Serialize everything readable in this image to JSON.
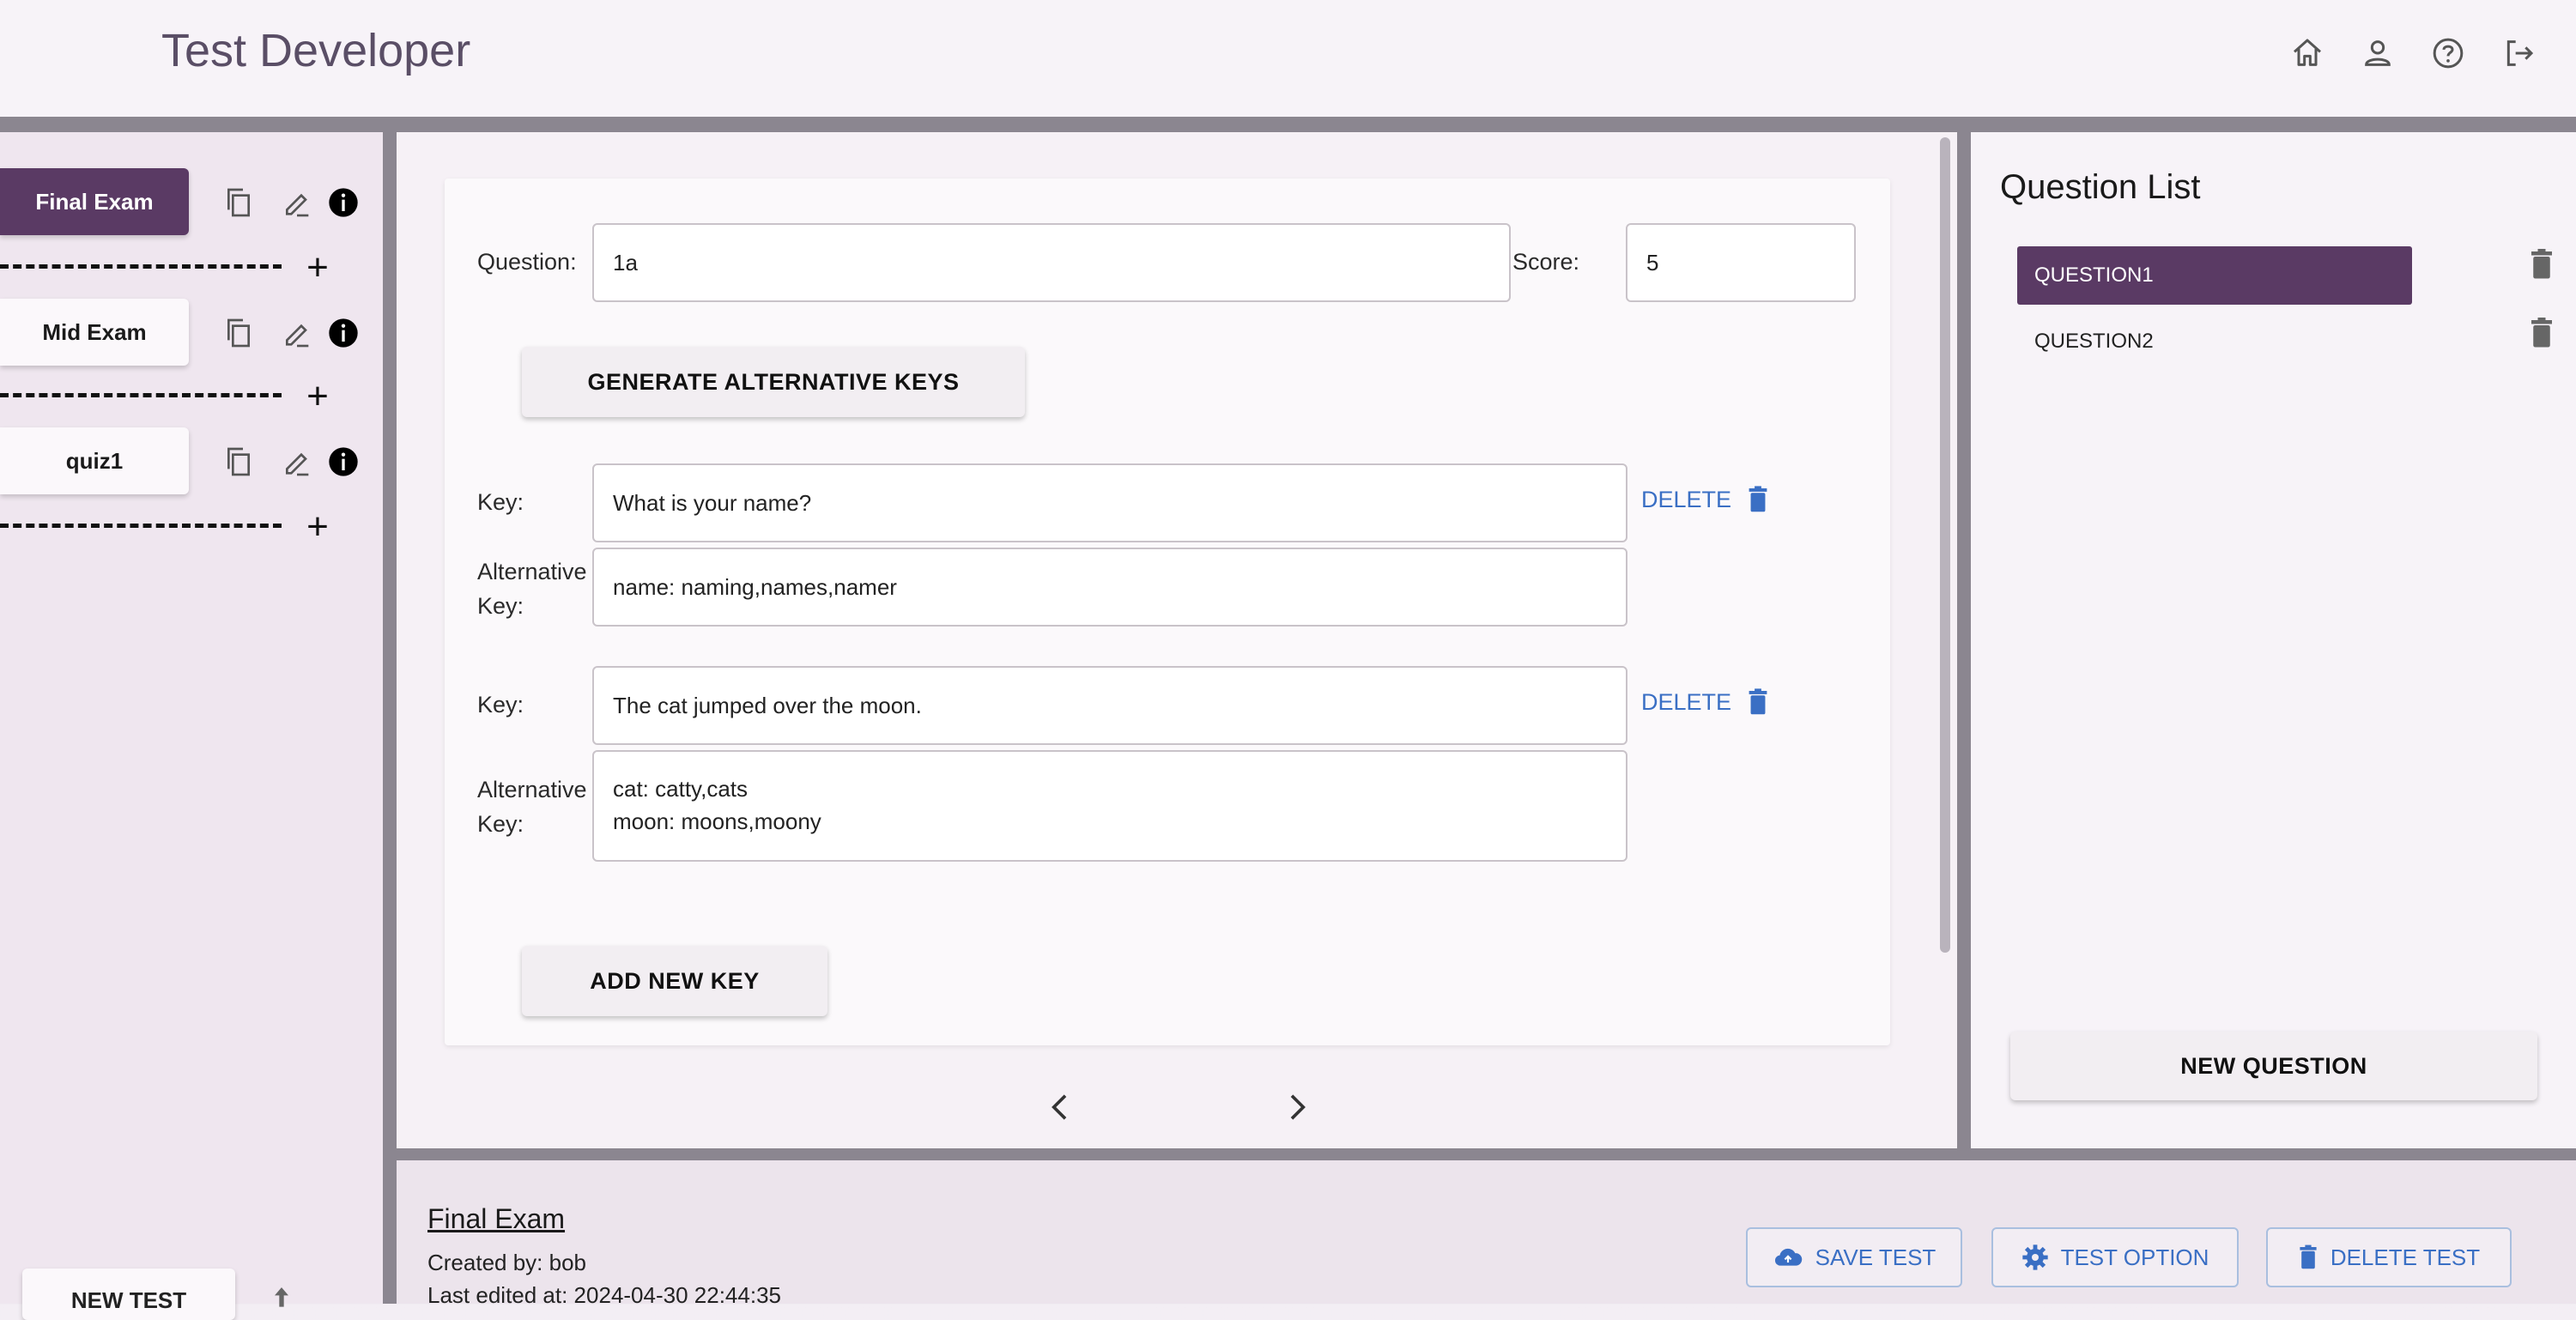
{
  "header": {
    "title": "Test Developer",
    "icons": [
      "home-icon",
      "user-icon",
      "help-icon",
      "logout-icon"
    ]
  },
  "sidebar": {
    "tests": [
      {
        "label": "Final Exam",
        "active": true
      },
      {
        "label": "Mid Exam",
        "active": false
      },
      {
        "label": "quiz1",
        "active": false
      }
    ],
    "new_test_label": "NEW TEST"
  },
  "editor": {
    "question_label": "Question:",
    "question_value": "1a",
    "score_label": "Score:",
    "score_value": "5",
    "generate_label": "GENERATE ALTERNATIVE KEYS",
    "key_label": "Key:",
    "alt_label": "Alternative\nKey:",
    "delete_label": "DELETE",
    "keys": [
      {
        "key": "What is your name?",
        "alt": "name: naming,names,namer"
      },
      {
        "key": "The cat jumped over the moon.",
        "alt": "cat: catty,cats\nmoon: moons,moony"
      }
    ],
    "add_key_label": "ADD NEW KEY"
  },
  "question_list": {
    "title": "Question List",
    "items": [
      {
        "label": "QUESTION1",
        "active": true
      },
      {
        "label": "QUESTION2",
        "active": false
      }
    ],
    "new_question_label": "NEW QUESTION"
  },
  "footer": {
    "test_title": "Final Exam",
    "created_by": "Created by: bob",
    "last_edited": "Last edited at: 2024-04-30 22:44:35",
    "save_label": "SAVE TEST",
    "option_label": "TEST OPTION",
    "delete_label": "DELETE TEST"
  },
  "colors": {
    "accent": "#5a3a64",
    "link": "#3a6fc4",
    "divider": "#8b8690"
  }
}
